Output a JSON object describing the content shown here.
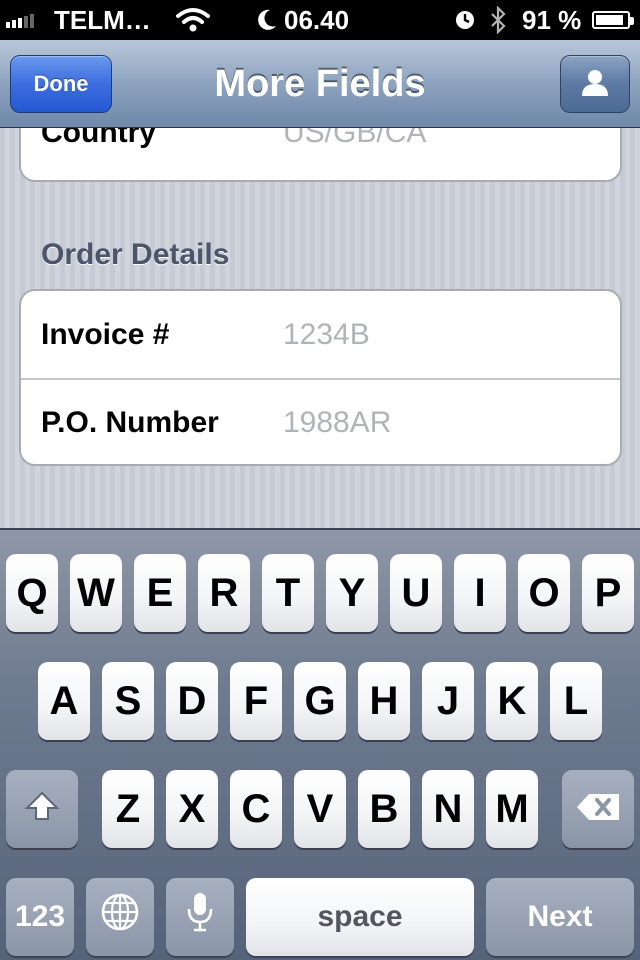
{
  "status_bar": {
    "carrier": "TELM…",
    "time": "06.40",
    "battery_percent": "91 %",
    "battery_level": 0.91,
    "icons": [
      "signal-icon",
      "wifi-icon",
      "moon-icon",
      "alarm-icon",
      "bluetooth-icon",
      "battery-icon"
    ]
  },
  "nav": {
    "title": "More Fields",
    "done_label": "Done",
    "right_icon": "contact-icon"
  },
  "top_group": {
    "label": "Country",
    "placeholder": "US/GB/CA"
  },
  "order_details": {
    "title": "Order Details",
    "rows": [
      {
        "label": "Invoice #",
        "placeholder": "1234B"
      },
      {
        "label": "P.O. Number",
        "placeholder": "1988AR"
      }
    ]
  },
  "keyboard": {
    "row1": [
      "Q",
      "W",
      "E",
      "R",
      "T",
      "Y",
      "U",
      "I",
      "O",
      "P"
    ],
    "row2": [
      "A",
      "S",
      "D",
      "F",
      "G",
      "H",
      "J",
      "K",
      "L"
    ],
    "row3": [
      "Z",
      "X",
      "C",
      "V",
      "B",
      "N",
      "M"
    ],
    "numbers_label": "123",
    "space_label": "space",
    "next_label": "Next",
    "icons": [
      "shift-icon",
      "backspace-icon",
      "globe-icon",
      "microphone-icon"
    ]
  },
  "colors": {
    "done_button": "#2f62d8",
    "nav_bar": "#8da3bf",
    "placeholder_text": "#b1b3b8"
  }
}
